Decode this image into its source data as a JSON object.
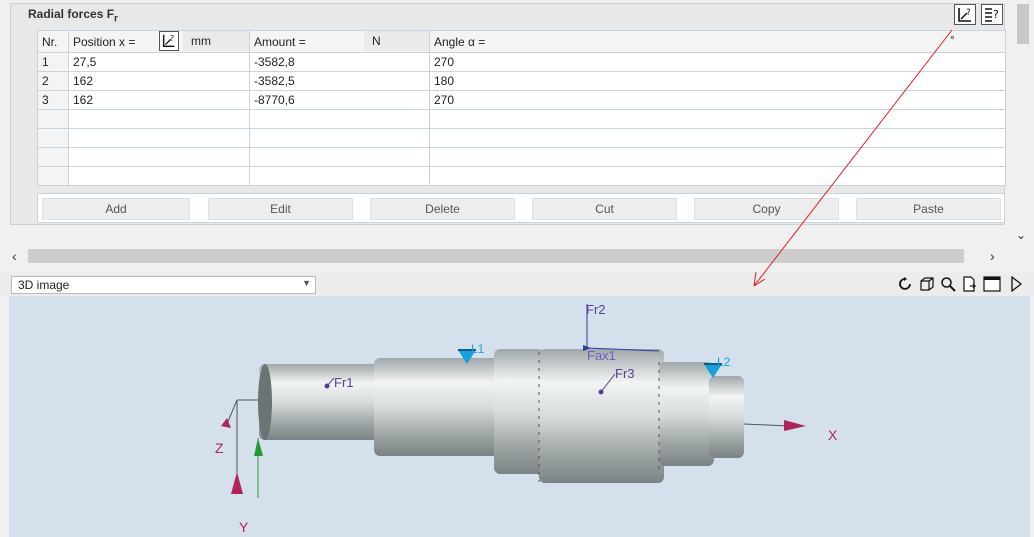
{
  "group": {
    "title": "Radial forces F",
    "title_sub": "r"
  },
  "table": {
    "headers": {
      "nr": "Nr.",
      "position": "Position x =",
      "position_unit": "mm",
      "amount": "Amount =",
      "amount_unit": "N",
      "angle": "Angle α =",
      "angle_unit": "°"
    },
    "rows": [
      {
        "nr": "1",
        "position": "27,5",
        "amount": "-3582,8",
        "angle": "270"
      },
      {
        "nr": "2",
        "position": "162",
        "amount": "-3582,5",
        "angle": "180"
      },
      {
        "nr": "3",
        "position": "162",
        "amount": "-8770,6",
        "angle": "270"
      }
    ]
  },
  "buttons": {
    "add": "Add",
    "edit": "Edit",
    "delete": "Delete",
    "cut": "Cut",
    "copy": "Copy",
    "paste": "Paste"
  },
  "view": {
    "mode": "3D image"
  },
  "scene": {
    "labels": {
      "fr1": "Fr1",
      "fr2": "Fr2",
      "fr3": "Fr3",
      "fax1": "Fax1",
      "l1": "L1",
      "l2": "L2",
      "x": "X",
      "y": "Y",
      "z": "Z"
    },
    "colors": {
      "background": "#d4e0ec",
      "force": "#5a3f8f",
      "bearing": "#1aa0d8",
      "axis_x": "#b0245a",
      "axis_y": "#1f9e2f",
      "annotation": "#e02020"
    }
  },
  "icons": {
    "header_sketch": "sketch-help-icon",
    "header_help": "list-help-icon",
    "rotate": "rotate-icon",
    "cube": "cube-icon",
    "zoom": "zoom-icon",
    "export": "export-icon",
    "window": "window-icon",
    "play": "play-icon"
  }
}
